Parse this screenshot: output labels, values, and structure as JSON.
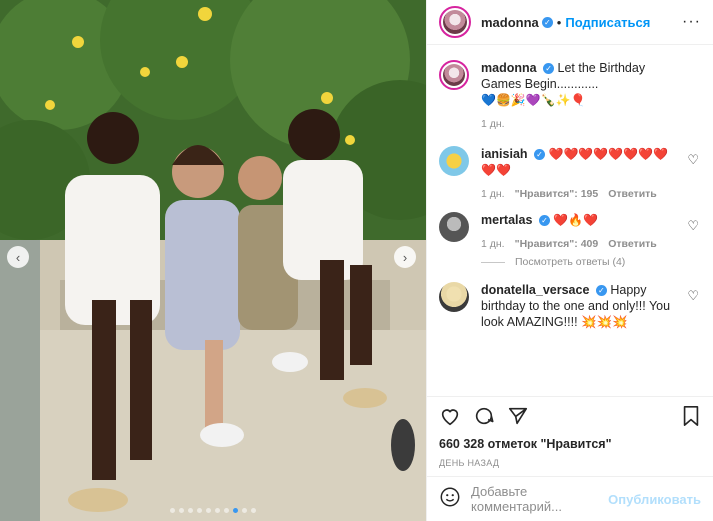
{
  "colors": {
    "accent": "#0095f6",
    "verified": "#3897f0",
    "heart": "#ed4956",
    "muted": "#8e8e8e"
  },
  "photo": {
    "description_icon": "photo",
    "carousel_dots_total": 10,
    "carousel_active_index": 7
  },
  "header": {
    "username": "madonna",
    "separator": "•",
    "follow_label": "Подписаться",
    "more_icon": "ellipsis-icon"
  },
  "caption": {
    "username": "madonna",
    "text": "Let the Birthday Games Begin............",
    "emojis": "💙🍔🎉💜🍾✨🎈",
    "time": "1 дн."
  },
  "comments": [
    {
      "username": "ianisiah",
      "text": "❤️❤️❤️❤️❤️❤️❤️❤️❤️❤️",
      "time": "1 дн.",
      "likes": "\"Нравится\": 195",
      "reply": "Ответить"
    },
    {
      "username": "mertalas",
      "text": "❤️🔥❤️",
      "time": "1 дн.",
      "likes": "\"Нравится\": 409",
      "reply": "Ответить",
      "view_replies": "Посмотреть ответы (4)"
    },
    {
      "username": "donatella_versace",
      "text": "Happy birthday to the one and only!!! You look AMAZING!!!! 💥💥💥",
      "time": "",
      "likes": "",
      "reply": ""
    }
  ],
  "footer": {
    "likes_text": "660 328 отметок \"Нравится\"",
    "date_text": "ДЕНЬ НАЗАД",
    "add_comment_placeholder": "Добавьте комментарий...",
    "publish_label": "Опубликовать"
  }
}
